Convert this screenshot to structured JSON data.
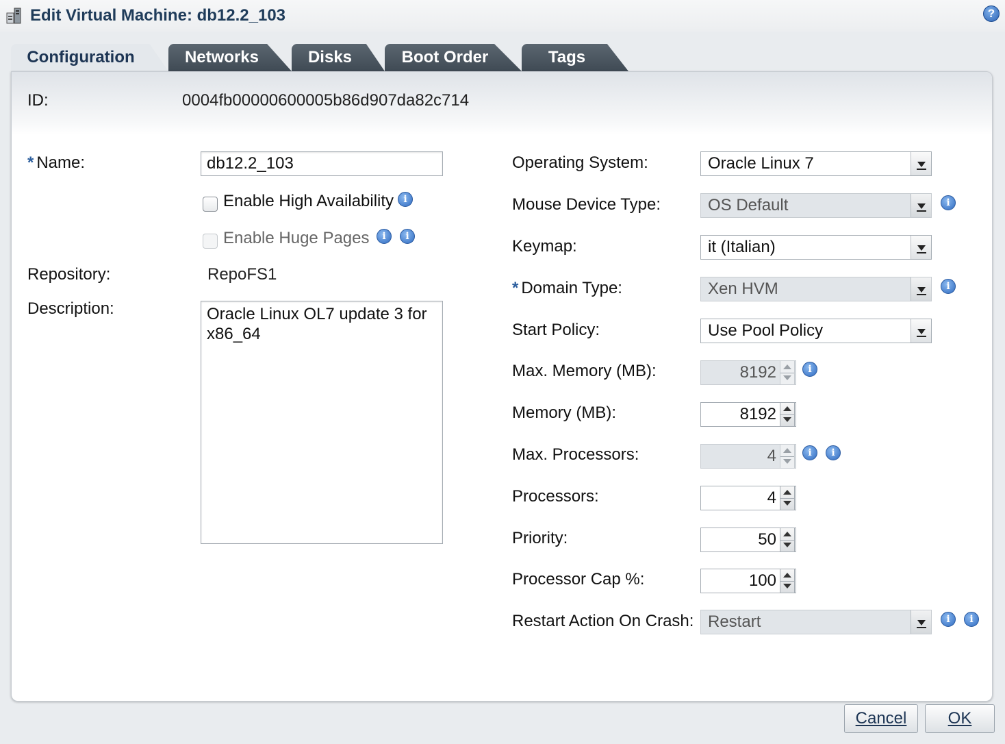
{
  "window": {
    "title": "Edit Virtual Machine: db12.2_103",
    "help_icon": "?"
  },
  "tabs": [
    {
      "label": "Configuration",
      "active": true
    },
    {
      "label": "Networks",
      "active": false
    },
    {
      "label": "Disks",
      "active": false
    },
    {
      "label": "Boot Order",
      "active": false
    },
    {
      "label": "Tags",
      "active": false
    }
  ],
  "info_glyph": "i",
  "id_row": {
    "label": "ID:",
    "value": "0004fb00000600005b86d907da82c714"
  },
  "left": {
    "name": {
      "required_mark": "*",
      "label": "Name:",
      "value": "db12.2_103"
    },
    "enable_ha": {
      "label": "Enable High Availability",
      "checked": false,
      "disabled": false
    },
    "enable_huge_pages": {
      "label": "Enable Huge Pages",
      "checked": false,
      "disabled": true
    },
    "repository": {
      "label": "Repository:",
      "value": "RepoFS1"
    },
    "description": {
      "label": "Description:",
      "value": "Oracle Linux OL7 update 3 for x86_64"
    }
  },
  "right": {
    "operating_system": {
      "label": "Operating System:",
      "value": "Oracle Linux 7"
    },
    "mouse_device_type": {
      "label": "Mouse Device Type:",
      "value": "OS Default"
    },
    "keymap": {
      "label": "Keymap:",
      "value": "it (Italian)"
    },
    "domain_type": {
      "required_mark": "*",
      "label": "Domain Type:",
      "value": "Xen HVM"
    },
    "start_policy": {
      "label": "Start Policy:",
      "value": "Use Pool Policy"
    },
    "max_memory": {
      "label": "Max. Memory (MB):",
      "value": "8192"
    },
    "memory": {
      "label": "Memory (MB):",
      "value": "8192"
    },
    "max_processors": {
      "label": "Max. Processors:",
      "value": "4"
    },
    "processors": {
      "label": "Processors:",
      "value": "4"
    },
    "priority": {
      "label": "Priority:",
      "value": "50"
    },
    "processor_cap": {
      "label": "Processor Cap %:",
      "value": "100"
    },
    "restart_action": {
      "label": "Restart Action On Crash:",
      "value": "Restart"
    }
  },
  "buttons": {
    "cancel": "Cancel",
    "ok": "OK"
  },
  "colors": {
    "title": "#1f3c5a",
    "info_icon": "#2f6bc1",
    "tab_inactive": "#4a555f"
  }
}
